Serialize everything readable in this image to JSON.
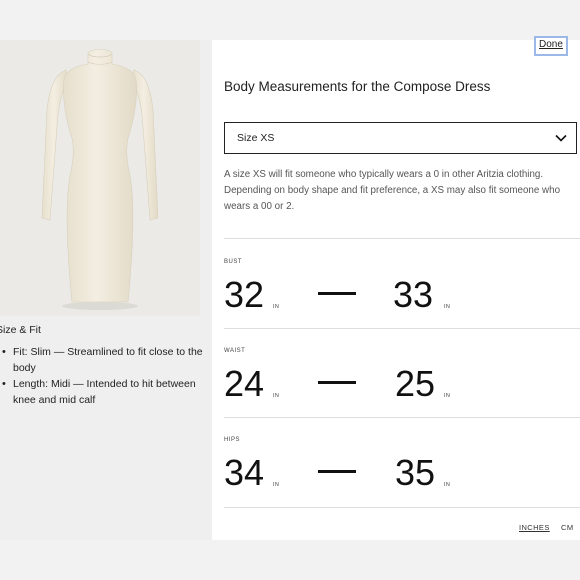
{
  "product": {
    "image_alt": "Compose Dress, cream, long sleeve midi",
    "dress_color": "#efe9da",
    "size_fit_heading": "Size & Fit",
    "fit_items": [
      "Fit: Slim — Streamlined to fit close to the body",
      "Length: Midi — Intended to hit between knee and mid calf"
    ]
  },
  "modal": {
    "done_label": "Done",
    "title": "Body Measurements for the Compose Dress",
    "size_select": {
      "selected": "Size XS",
      "icon": "chevron-down-icon"
    },
    "description": "A size XS will fit someone who typically wears a 0 in other Aritzia clothing. Depending on body shape and fit preference, a XS may also fit someone who wears a 00 or 2.",
    "measurements": [
      {
        "label": "BUST",
        "min": "32",
        "max": "33",
        "unit": "IN"
      },
      {
        "label": "WAIST",
        "min": "24",
        "max": "25",
        "unit": "IN"
      },
      {
        "label": "HIPS",
        "min": "34",
        "max": "35",
        "unit": "IN"
      }
    ],
    "units": {
      "inches": "INCHES",
      "cm": "CM",
      "active": "inches"
    }
  }
}
